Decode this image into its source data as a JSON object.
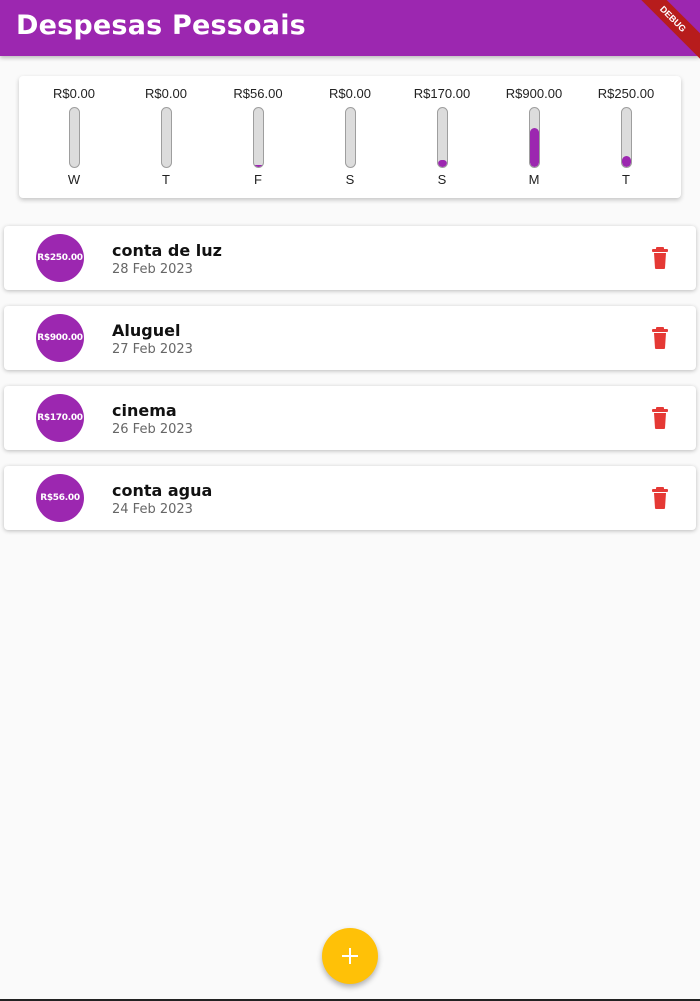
{
  "app": {
    "title": "Despesas Pessoais",
    "debug_label": "DEBUG",
    "accent_color": "#9c27b0",
    "fab_color": "#ffc107",
    "delete_color": "#e53935"
  },
  "chart": {
    "bars": [
      {
        "day": "W",
        "value": "R$0.00",
        "fraction": 0.0
      },
      {
        "day": "T",
        "value": "R$0.00",
        "fraction": 0.0
      },
      {
        "day": "F",
        "value": "R$56.00",
        "fraction": 0.04
      },
      {
        "day": "S",
        "value": "R$0.00",
        "fraction": 0.0
      },
      {
        "day": "S",
        "value": "R$170.00",
        "fraction": 0.123
      },
      {
        "day": "M",
        "value": "R$900.00",
        "fraction": 0.654
      },
      {
        "day": "T",
        "value": "R$250.00",
        "fraction": 0.182
      }
    ]
  },
  "transactions": [
    {
      "amount": "R$250.00",
      "title": "conta de luz",
      "date": "28 Feb 2023",
      "delete_icon": "trash-icon"
    },
    {
      "amount": "R$900.00",
      "title": "Aluguel",
      "date": "27 Feb 2023",
      "delete_icon": "trash-icon"
    },
    {
      "amount": "R$170.00",
      "title": "cinema",
      "date": "26 Feb 2023",
      "delete_icon": "trash-icon"
    },
    {
      "amount": "R$56.00",
      "title": "conta agua",
      "date": "24 Feb 2023",
      "delete_icon": "trash-icon"
    }
  ],
  "fab": {
    "icon": "plus-icon"
  }
}
